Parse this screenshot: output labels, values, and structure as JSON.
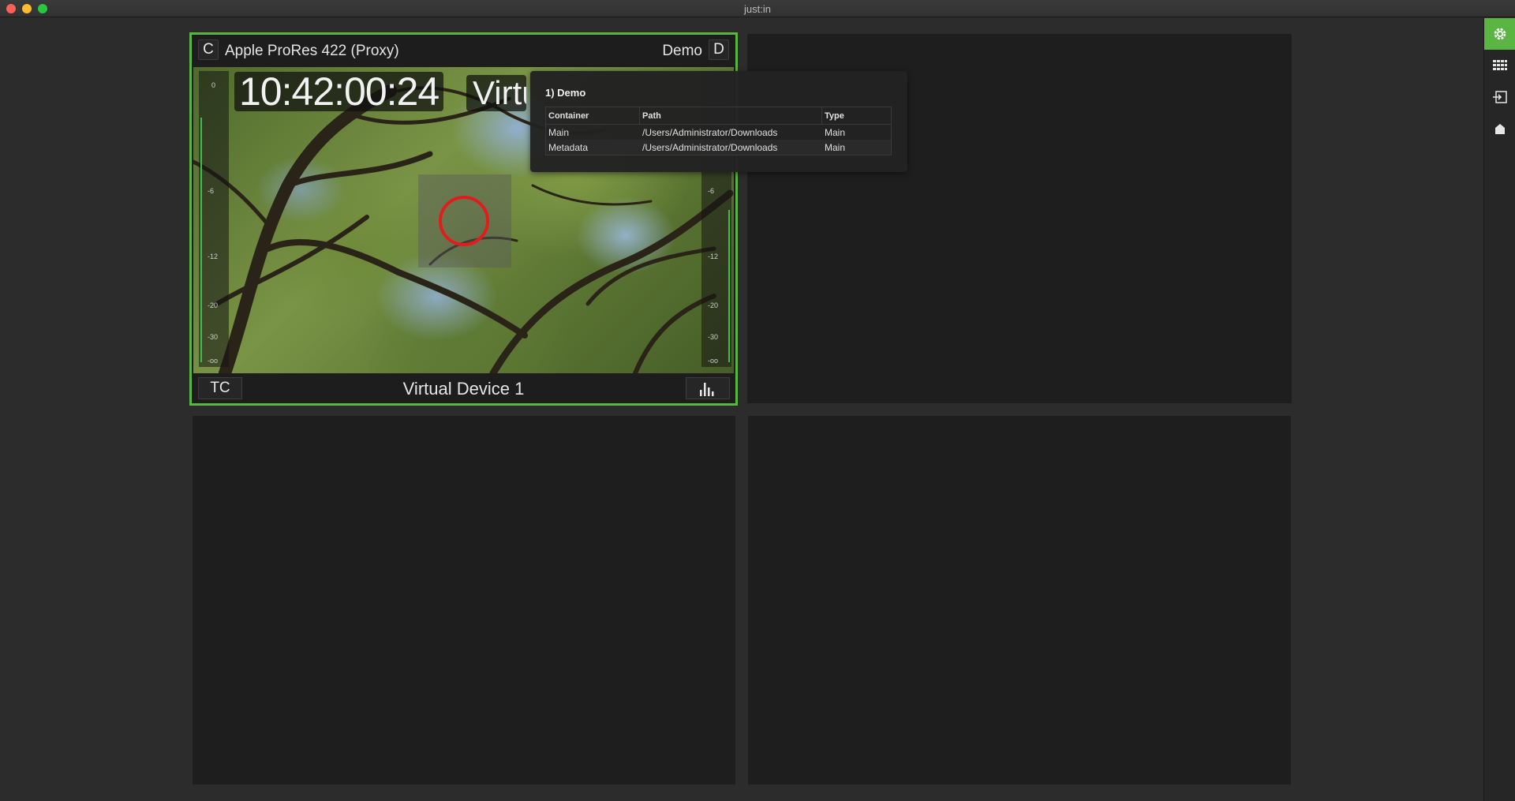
{
  "window": {
    "title": "just:in"
  },
  "sidebar": {
    "items": [
      {
        "icon": "gear-icon",
        "active": true
      },
      {
        "icon": "grid-icon",
        "active": false
      },
      {
        "icon": "sign-in-icon",
        "active": false
      },
      {
        "icon": "home-icon",
        "active": false
      }
    ]
  },
  "panel1": {
    "left_key": "C",
    "codec": "Apple ProRes 422 (Proxy)",
    "project": "Demo",
    "right_key": "D",
    "timecode": "10:42:00:24",
    "device_overlay": "Virtual Device 1",
    "device_label": "Virtual Device 1",
    "tc_button": "TC",
    "meter_scale": [
      "0",
      "-6",
      "-12",
      "-20",
      "-30",
      "-oo"
    ],
    "left_meter_level": 0.85,
    "right_meter_level": 0.53
  },
  "popover": {
    "title": "1) Demo",
    "columns": [
      "Container",
      "Path",
      "Type"
    ],
    "rows": [
      {
        "container": "Main",
        "path": "/Users/Administrator/Downloads",
        "type": "Main"
      },
      {
        "container": "Metadata",
        "path": "/Users/Administrator/Downloads",
        "type": "Main"
      }
    ]
  },
  "colors": {
    "accent": "#5bb543",
    "focus_ring": "#e21c1c",
    "meter": "#3bbf4a"
  }
}
